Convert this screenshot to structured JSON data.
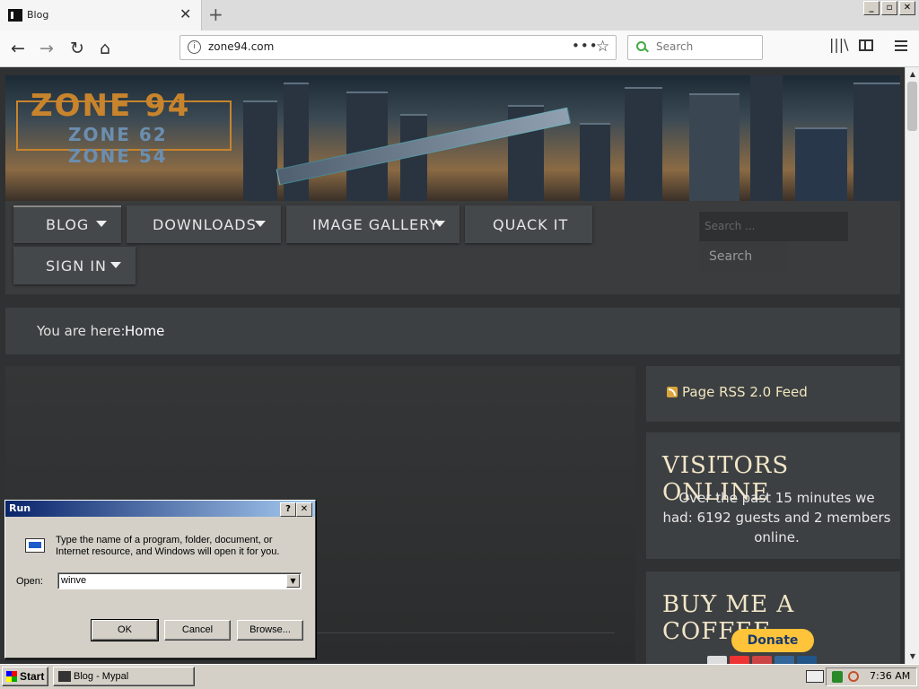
{
  "browser": {
    "tab_title": "Blog",
    "tab_close": "✕",
    "new_tab": "+",
    "url": "zone94.com",
    "url_more": "•••",
    "search_placeholder": "Search",
    "window_buttons": [
      "_",
      "▫",
      "✕"
    ]
  },
  "site": {
    "logo_main": "ZONE 94",
    "logo_sub1": "ZONE 62",
    "logo_sub2": "ZONE 54",
    "menu": [
      {
        "label": "BLOG",
        "has_dropdown": true,
        "active": true
      },
      {
        "label": "DOWNLOADS",
        "has_dropdown": true
      },
      {
        "label": "IMAGE GALLERY",
        "has_dropdown": true
      },
      {
        "label": "QUACK IT",
        "has_dropdown": false
      },
      {
        "label": "SIGN IN",
        "has_dropdown": true
      }
    ],
    "search_placeholder": "Search ...",
    "search_button": "Search",
    "breadcrumb_lead": "You are here:",
    "breadcrumb_current": "Home",
    "rss_label": "Page RSS 2.0 Feed",
    "visitors_title": "VISITORS ONLINE",
    "visitors_text": "Over the past 15 minutes we had: 6192 guests and 2 members online.",
    "coffee_title": "BUY ME A COFFEE",
    "donate_label": "Donate",
    "accent_color": "#d9a53c"
  },
  "run_dialog": {
    "title": "Run",
    "help": "?",
    "close": "✕",
    "description": "Type the name of a program, folder, document, or Internet resource, and Windows will open it for you.",
    "open_label": "Open:",
    "open_value": "winve",
    "ok": "OK",
    "cancel": "Cancel",
    "browse": "Browse..."
  },
  "taskbar": {
    "start": "Start",
    "task": "Blog - Mypal",
    "clock": "7:36 AM"
  }
}
